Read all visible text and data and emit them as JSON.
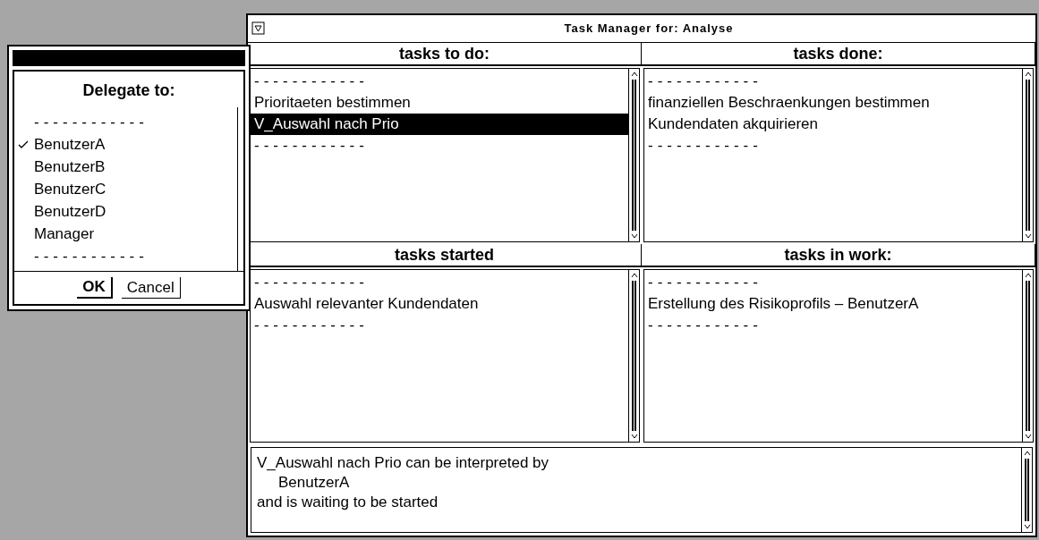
{
  "dialog": {
    "title": "Delegate to:",
    "items": [
      {
        "kind": "separator",
        "label": "------------",
        "checked": false
      },
      {
        "kind": "option",
        "label": "BenutzerA",
        "checked": true
      },
      {
        "kind": "option",
        "label": "BenutzerB",
        "checked": false
      },
      {
        "kind": "option",
        "label": "BenutzerC",
        "checked": false
      },
      {
        "kind": "option",
        "label": "BenutzerD",
        "checked": false
      },
      {
        "kind": "option",
        "label": "Manager",
        "checked": false
      },
      {
        "kind": "separator",
        "label": "------------",
        "checked": false
      }
    ],
    "buttons": [
      {
        "label": "OK",
        "default": true
      },
      {
        "label": "Cancel",
        "default": false
      }
    ]
  },
  "window": {
    "title": "Task Manager for: Analyse"
  },
  "panes": [
    {
      "title": "tasks to do:",
      "items": [
        {
          "kind": "separator",
          "label": "------------",
          "selected": false
        },
        {
          "kind": "task",
          "label": "Prioritaeten bestimmen",
          "selected": false
        },
        {
          "kind": "task",
          "label": "V_Auswahl nach Prio",
          "selected": true
        },
        {
          "kind": "separator",
          "label": "------------",
          "selected": false
        }
      ]
    },
    {
      "title": "tasks done:",
      "items": [
        {
          "kind": "separator",
          "label": "------------",
          "selected": false
        },
        {
          "kind": "task",
          "label": "finanziellen Beschraenkungen bestimmen",
          "selected": false
        },
        {
          "kind": "task",
          "label": "Kundendaten akquirieren",
          "selected": false
        },
        {
          "kind": "separator",
          "label": "------------",
          "selected": false
        }
      ]
    },
    {
      "title": "tasks started",
      "items": [
        {
          "kind": "separator",
          "label": "------------",
          "selected": false
        },
        {
          "kind": "task",
          "label": "Auswahl relevanter Kundendaten",
          "selected": false
        },
        {
          "kind": "separator",
          "label": "------------",
          "selected": false
        }
      ]
    },
    {
      "title": "tasks in work:",
      "items": [
        {
          "kind": "separator",
          "label": "------------",
          "selected": false
        },
        {
          "kind": "task",
          "label": "Erstellung des Risikoprofils – BenutzerA",
          "selected": false
        },
        {
          "kind": "separator",
          "label": "------------",
          "selected": false
        }
      ]
    }
  ],
  "message": {
    "lines": [
      {
        "text": "V_Auswahl nach Prio can be interpreted by",
        "indent": false
      },
      {
        "text": "BenutzerA",
        "indent": true
      },
      {
        "text": "and is waiting to be started",
        "indent": false
      }
    ]
  }
}
